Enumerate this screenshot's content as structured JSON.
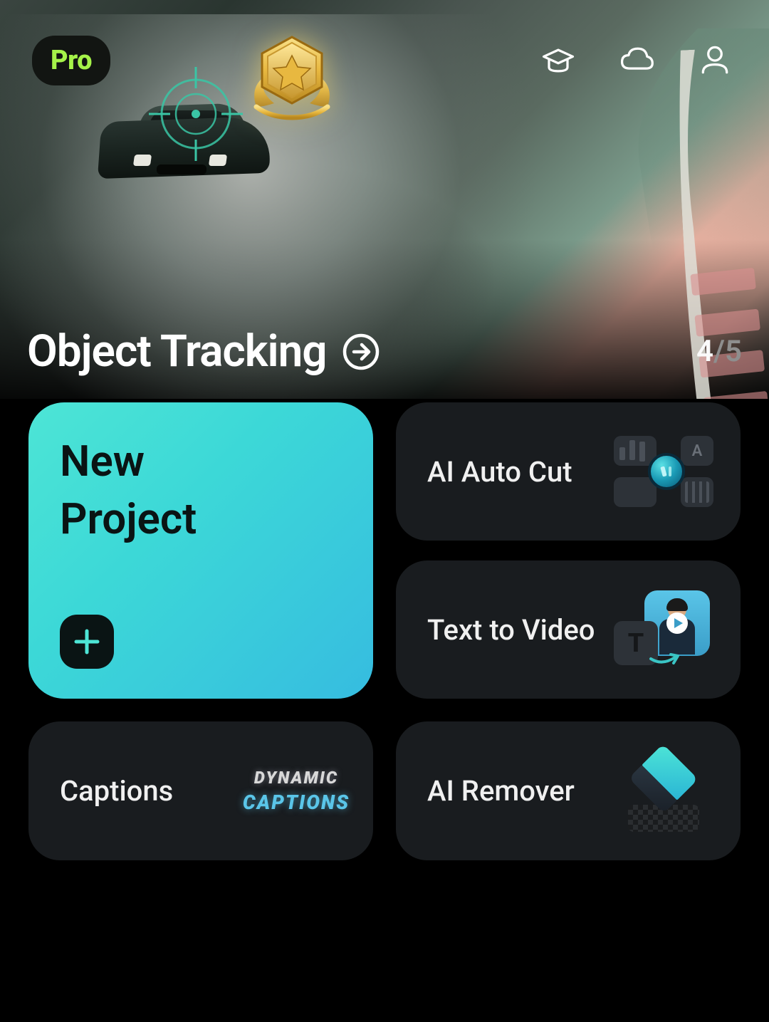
{
  "header": {
    "pro_badge": "Pro",
    "icons": {
      "learn": "graduation-cap-icon",
      "cloud": "cloud-icon",
      "profile": "person-icon"
    }
  },
  "hero": {
    "title": "Object Tracking",
    "action_icon": "arrow-right-circle-icon",
    "pager_current": "4",
    "pager_separator": "/",
    "pager_total": "5"
  },
  "cards": {
    "new_project": {
      "title_line1": "New",
      "title_line2": "Project",
      "plus_icon": "plus-icon"
    },
    "ai_auto_cut": {
      "label": "AI Auto Cut",
      "icon": "auto-cut-icon",
      "icon_letter": "A"
    },
    "text_to_video": {
      "label": "Text to Video",
      "icon": "text-to-video-icon",
      "t_glyph": "T"
    },
    "captions": {
      "label": "Captions",
      "icon_text_1": "DYNAMIC",
      "icon_text_2": "CAPTIONS"
    },
    "ai_remover": {
      "label": "AI Remover",
      "icon": "eraser-icon"
    }
  },
  "colors": {
    "accent_green": "#a5f349",
    "accent_teal": "#4de5d6",
    "card_bg": "#191c1f",
    "bg": "#000000"
  }
}
